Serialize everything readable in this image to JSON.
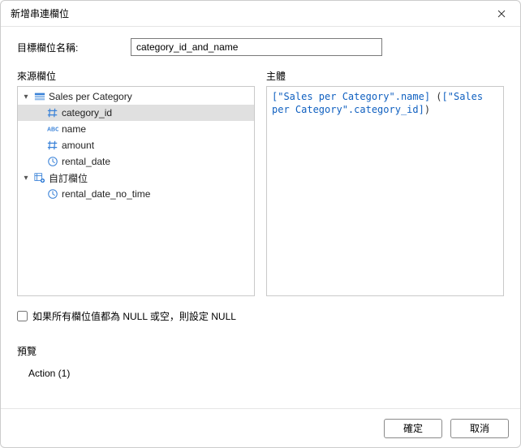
{
  "window": {
    "title": "新增串連欄位"
  },
  "target": {
    "label": "目標欄位名稱:",
    "value": "category_id_and_name"
  },
  "source": {
    "label": "來源欄位",
    "groups": [
      {
        "type": "table",
        "label": "Sales per Category",
        "children": [
          {
            "icon": "hash",
            "label": "category_id",
            "selected": true
          },
          {
            "icon": "abc",
            "label": "name"
          },
          {
            "icon": "hash",
            "label": "amount"
          },
          {
            "icon": "clock",
            "label": "rental_date"
          }
        ]
      },
      {
        "type": "custom",
        "label": "自訂欄位",
        "children": [
          {
            "icon": "clock",
            "label": "rental_date_no_time"
          }
        ]
      }
    ]
  },
  "body": {
    "label": "主體",
    "expr_seg1": "[\"Sales per Category\".name]",
    "expr_paren_open": " (",
    "expr_seg2": "[\"Sales per Category\".category_id]",
    "expr_paren_close": ")"
  },
  "null_option": {
    "label": "如果所有欄位值都為 NULL 或空，則設定 NULL",
    "checked": false
  },
  "preview": {
    "label": "預覽",
    "value": "Action (1)"
  },
  "buttons": {
    "ok": "確定",
    "cancel": "取消"
  }
}
